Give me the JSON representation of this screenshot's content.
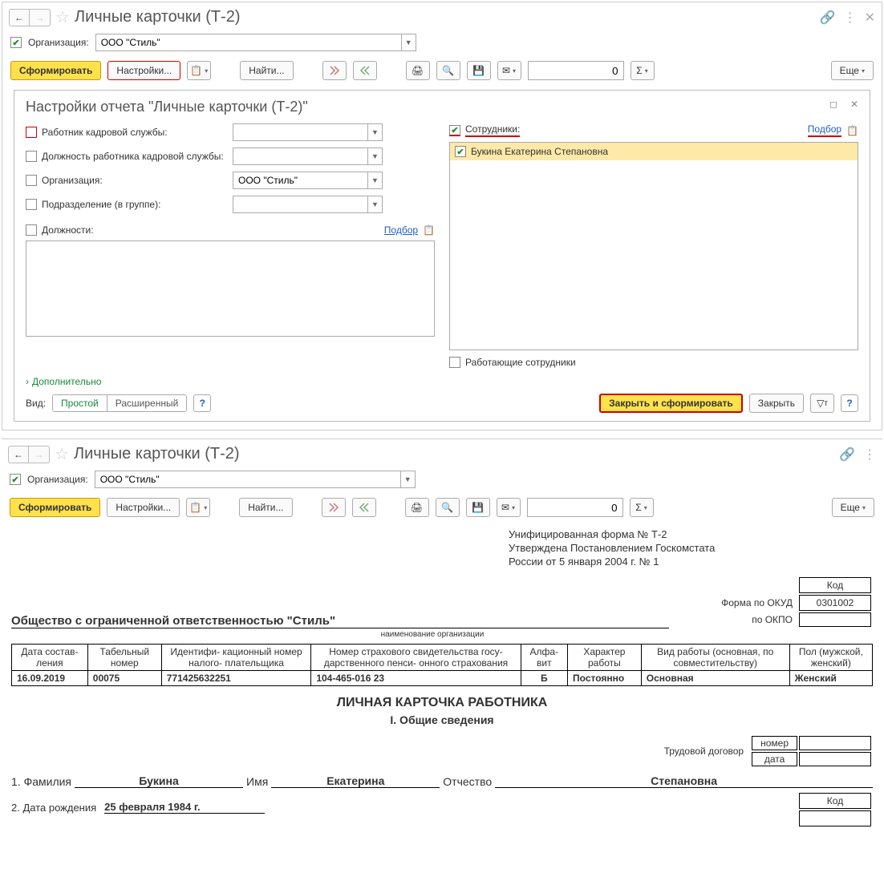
{
  "top": {
    "title": "Личные карточки (Т-2)",
    "org_label": "Организация:",
    "org_value": "ООО \"Стиль\"",
    "toolbar": {
      "generate": "Сформировать",
      "settings": "Настройки...",
      "find": "Найти...",
      "num_value": "0",
      "more": "Еще"
    }
  },
  "settings": {
    "title": "Настройки отчета \"Личные карточки (Т-2)\"",
    "hr_worker": "Работник кадровой службы:",
    "hr_position": "Должность работника кадровой службы:",
    "org_label": "Организация:",
    "org_value": "ООО \"Стиль\"",
    "dept": "Подразделение (в группе):",
    "positions": "Должности:",
    "pick": "Подбор",
    "employees_label": "Сотрудники:",
    "employee1": "Букина Екатерина Степановна",
    "working_employees": "Работающие сотрудники",
    "advanced": "Дополнительно",
    "view_label": "Вид:",
    "view_simple": "Простой",
    "view_ext": "Расширенный",
    "close_generate": "Закрыть и сформировать",
    "close": "Закрыть"
  },
  "bottom": {
    "title": "Личные карточки (Т-2)",
    "org_label": "Организация:",
    "org_value": "ООО \"Стиль\"",
    "toolbar": {
      "generate": "Сформировать",
      "settings": "Настройки...",
      "find": "Найти...",
      "num_value": "0",
      "more": "Еще"
    }
  },
  "doc": {
    "meta1": "Унифицированная форма № Т-2",
    "meta2": "Утверждена Постановлением Госкомстата",
    "meta3": "России от 5 января 2004 г. № 1",
    "code_label": "Код",
    "okud_label": "Форма по ОКУД",
    "okud_value": "0301002",
    "okpo_label": "по ОКПО",
    "org_name": "Общество с ограниченной ответственностью \"Стиль\"",
    "org_caption": "наименование организации",
    "headers": {
      "h1": "Дата состав- ления",
      "h2": "Табельный номер",
      "h3": "Идентифи- кационный номер налого- плательщика",
      "h4": "Номер страхового свидетельства госу- дарственного пенси- онного страхования",
      "h5": "Алфа- вит",
      "h6": "Характер работы",
      "h7": "Вид работы (основная, по совместительству)",
      "h8": "Пол (мужской, женский)"
    },
    "row": {
      "v1": "16.09.2019",
      "v2": "00075",
      "v3": "771425632251",
      "v4": "104-465-016 23",
      "v5": "Б",
      "v6": "Постоянно",
      "v7": "Основная",
      "v8": "Женский"
    },
    "card_title": "ЛИЧНАЯ КАРТОЧКА РАБОТНИКА",
    "section1": "I. Общие сведения",
    "contract_label": "Трудовой договор",
    "contract_num": "номер",
    "contract_date": "дата",
    "surname_label": "1. Фамилия",
    "surname_value": "Букина",
    "name_label": "Имя",
    "name_value": "Екатерина",
    "patronymic_label": "Отчество",
    "patronymic_value": "Степановна",
    "birth_label": "2. Дата рождения",
    "birth_value": "25 февраля 1984 г.",
    "code_label2": "Код"
  }
}
